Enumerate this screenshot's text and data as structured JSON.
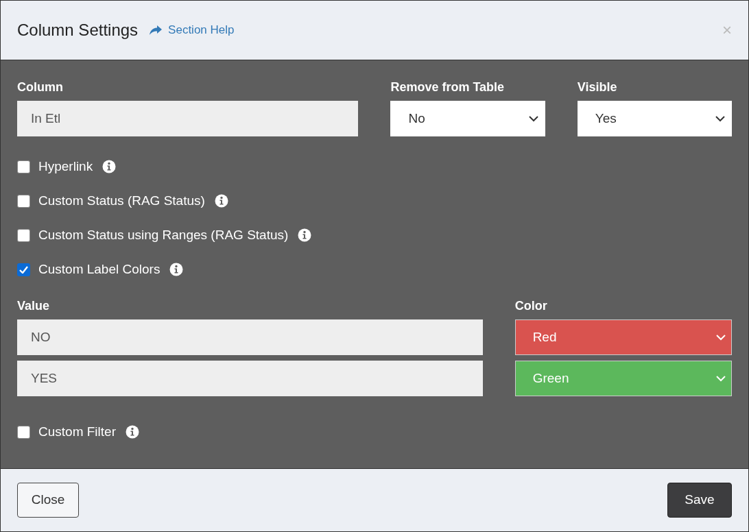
{
  "dialog": {
    "title": "Column Settings",
    "help_link": "Section Help",
    "close_icon": "×"
  },
  "fields": [
    {
      "kind": "text",
      "label": "Column",
      "value": "In Etl"
    },
    {
      "kind": "select",
      "label": "Remove from Table",
      "value": "No"
    },
    {
      "kind": "select",
      "label": "Visible",
      "value": "Yes"
    }
  ],
  "options": [
    {
      "label": "Hyperlink",
      "checked": false
    },
    {
      "label": "Custom Status (RAG Status)",
      "checked": false
    },
    {
      "label": "Custom Status using Ranges (RAG Status)",
      "checked": false
    },
    {
      "label": "Custom Label Colors",
      "checked": true
    }
  ],
  "label_colors": {
    "value_header": "Value",
    "color_header": "Color",
    "rows": [
      {
        "value": "NO",
        "color_label": "Red",
        "color": "#d9534f"
      },
      {
        "value": "YES",
        "color_label": "Green",
        "color": "#5cb85c"
      }
    ]
  },
  "filter_option": {
    "label": "Custom Filter",
    "checked": false
  },
  "buttons": [
    {
      "kind": "secondary",
      "label": "Close"
    },
    {
      "kind": "primary",
      "label": "Save"
    }
  ]
}
